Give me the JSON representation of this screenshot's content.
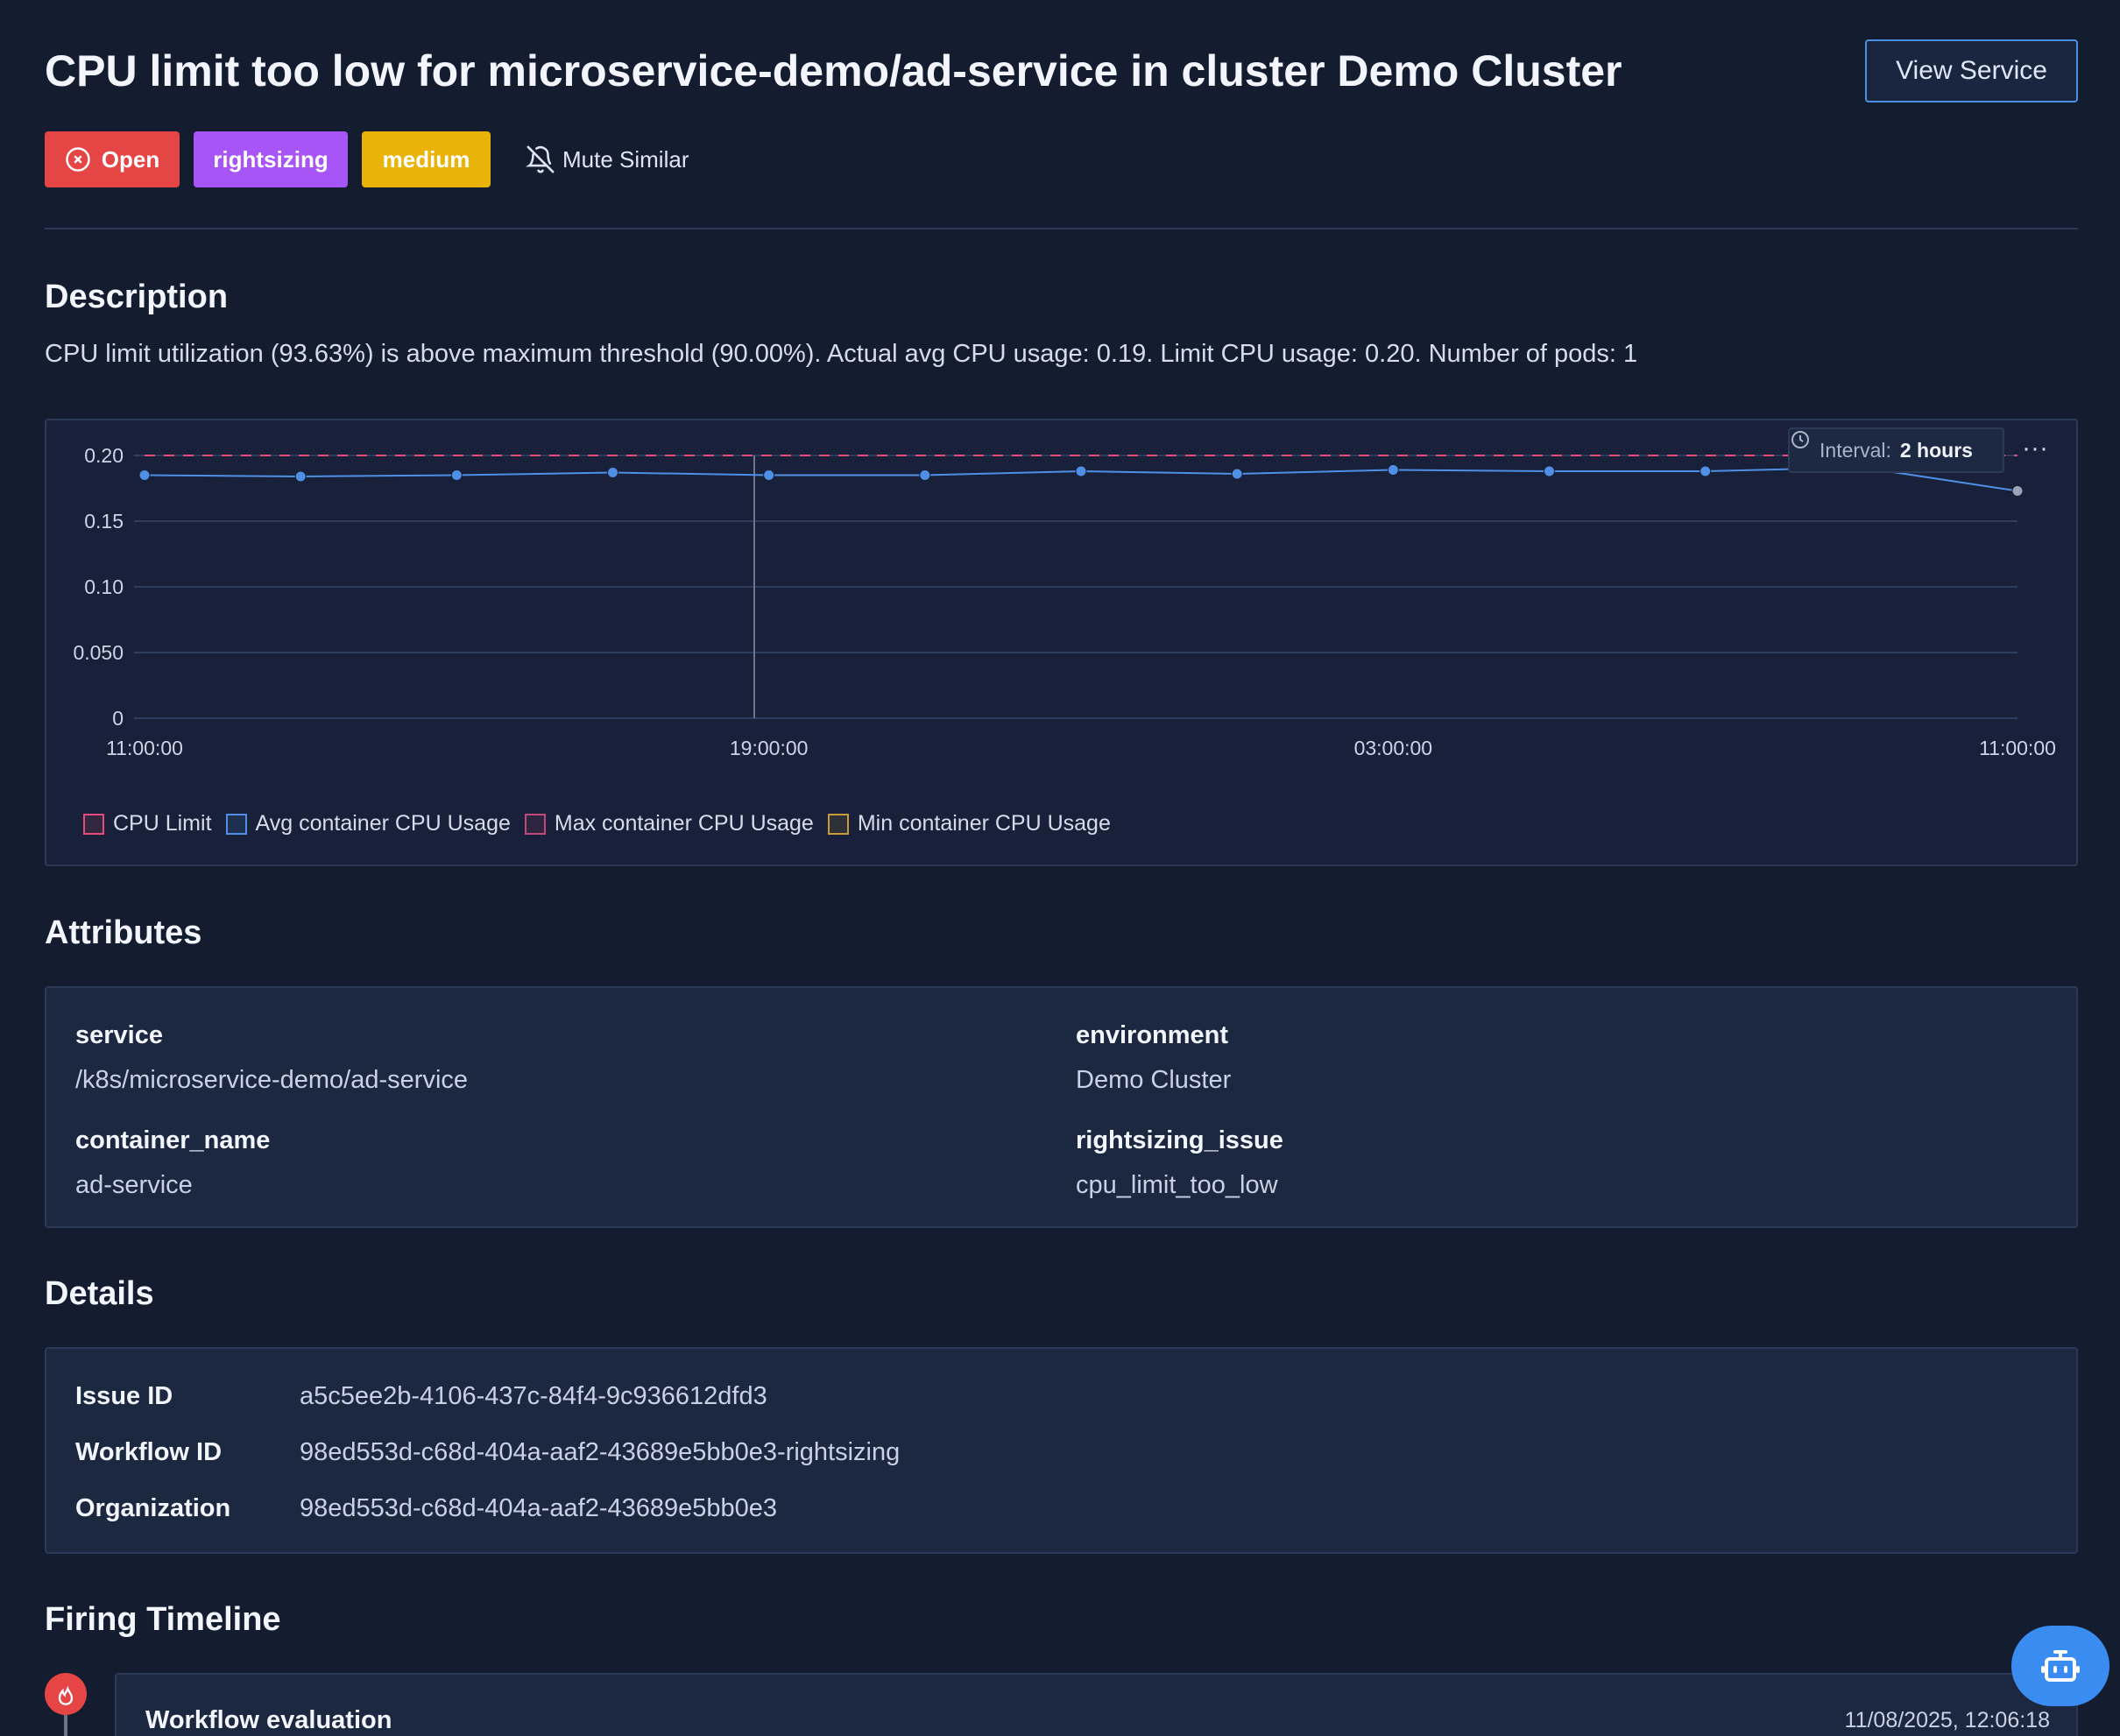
{
  "header": {
    "title": "CPU limit too low for microservice-demo/ad-service in cluster Demo Cluster",
    "view_button": "View Service",
    "badges": {
      "status": "Open",
      "category": "rightsizing",
      "severity": "medium"
    },
    "mute_label": "Mute Similar"
  },
  "description": {
    "heading": "Description",
    "text": "CPU limit utilization (93.63%) is above maximum threshold (90.00%). Actual avg CPU usage: 0.19. Limit CPU usage: 0.20. Number of pods: 1"
  },
  "chart": {
    "interval_label": "Interval:",
    "interval_value": "2 hours",
    "more_label": "···"
  },
  "chart_data": {
    "type": "line",
    "x_ticks": [
      "11:00:00",
      "19:00:00",
      "03:00:00",
      "11:00:00"
    ],
    "y_ticks": [
      "0",
      "0.050",
      "0.10",
      "0.15",
      "0.20"
    ],
    "ylim": [
      0,
      0.2
    ],
    "grid": true,
    "legend_position": "bottom-left",
    "series": [
      {
        "name": "CPU Limit",
        "color": "#e84a7a",
        "dashed": true,
        "values": [
          0.2,
          0.2,
          0.2,
          0.2,
          0.2,
          0.2,
          0.2,
          0.2,
          0.2,
          0.2,
          0.2,
          0.2,
          0.2,
          0.2
        ]
      },
      {
        "name": "Avg container CPU Usage",
        "color": "#4f8fe6",
        "dashed": false,
        "values": [
          0.185,
          0.184,
          0.185,
          0.187,
          0.185,
          0.185,
          0.188,
          0.186,
          0.189,
          0.188,
          0.188,
          0.191,
          0.173
        ]
      },
      {
        "name": "Max container CPU Usage",
        "color": "#c2477a",
        "dashed": false,
        "values": []
      },
      {
        "name": "Min container CPU Usage",
        "color": "#c99a3a",
        "dashed": false,
        "values": []
      }
    ]
  },
  "attributes": {
    "heading": "Attributes",
    "items": [
      {
        "key": "service",
        "value": "/k8s/microservice-demo/ad-service"
      },
      {
        "key": "environment",
        "value": "Demo Cluster"
      },
      {
        "key": "container_name",
        "value": "ad-service"
      },
      {
        "key": "rightsizing_issue",
        "value": "cpu_limit_too_low"
      }
    ]
  },
  "details": {
    "heading": "Details",
    "rows": [
      {
        "key": "Issue ID",
        "value": "a5c5ee2b-4106-437c-84f4-9c936612dfd3"
      },
      {
        "key": "Workflow ID",
        "value": "98ed553d-c68d-404a-aaf2-43689e5bb0e3-rightsizing"
      },
      {
        "key": "Organization",
        "value": "98ed553d-c68d-404a-aaf2-43689e5bb0e3"
      }
    ]
  },
  "timeline": {
    "heading": "Firing Timeline",
    "entries": [
      {
        "title": "Workflow evaluation",
        "date": "11/08/2025, 12:06:18"
      }
    ]
  }
}
